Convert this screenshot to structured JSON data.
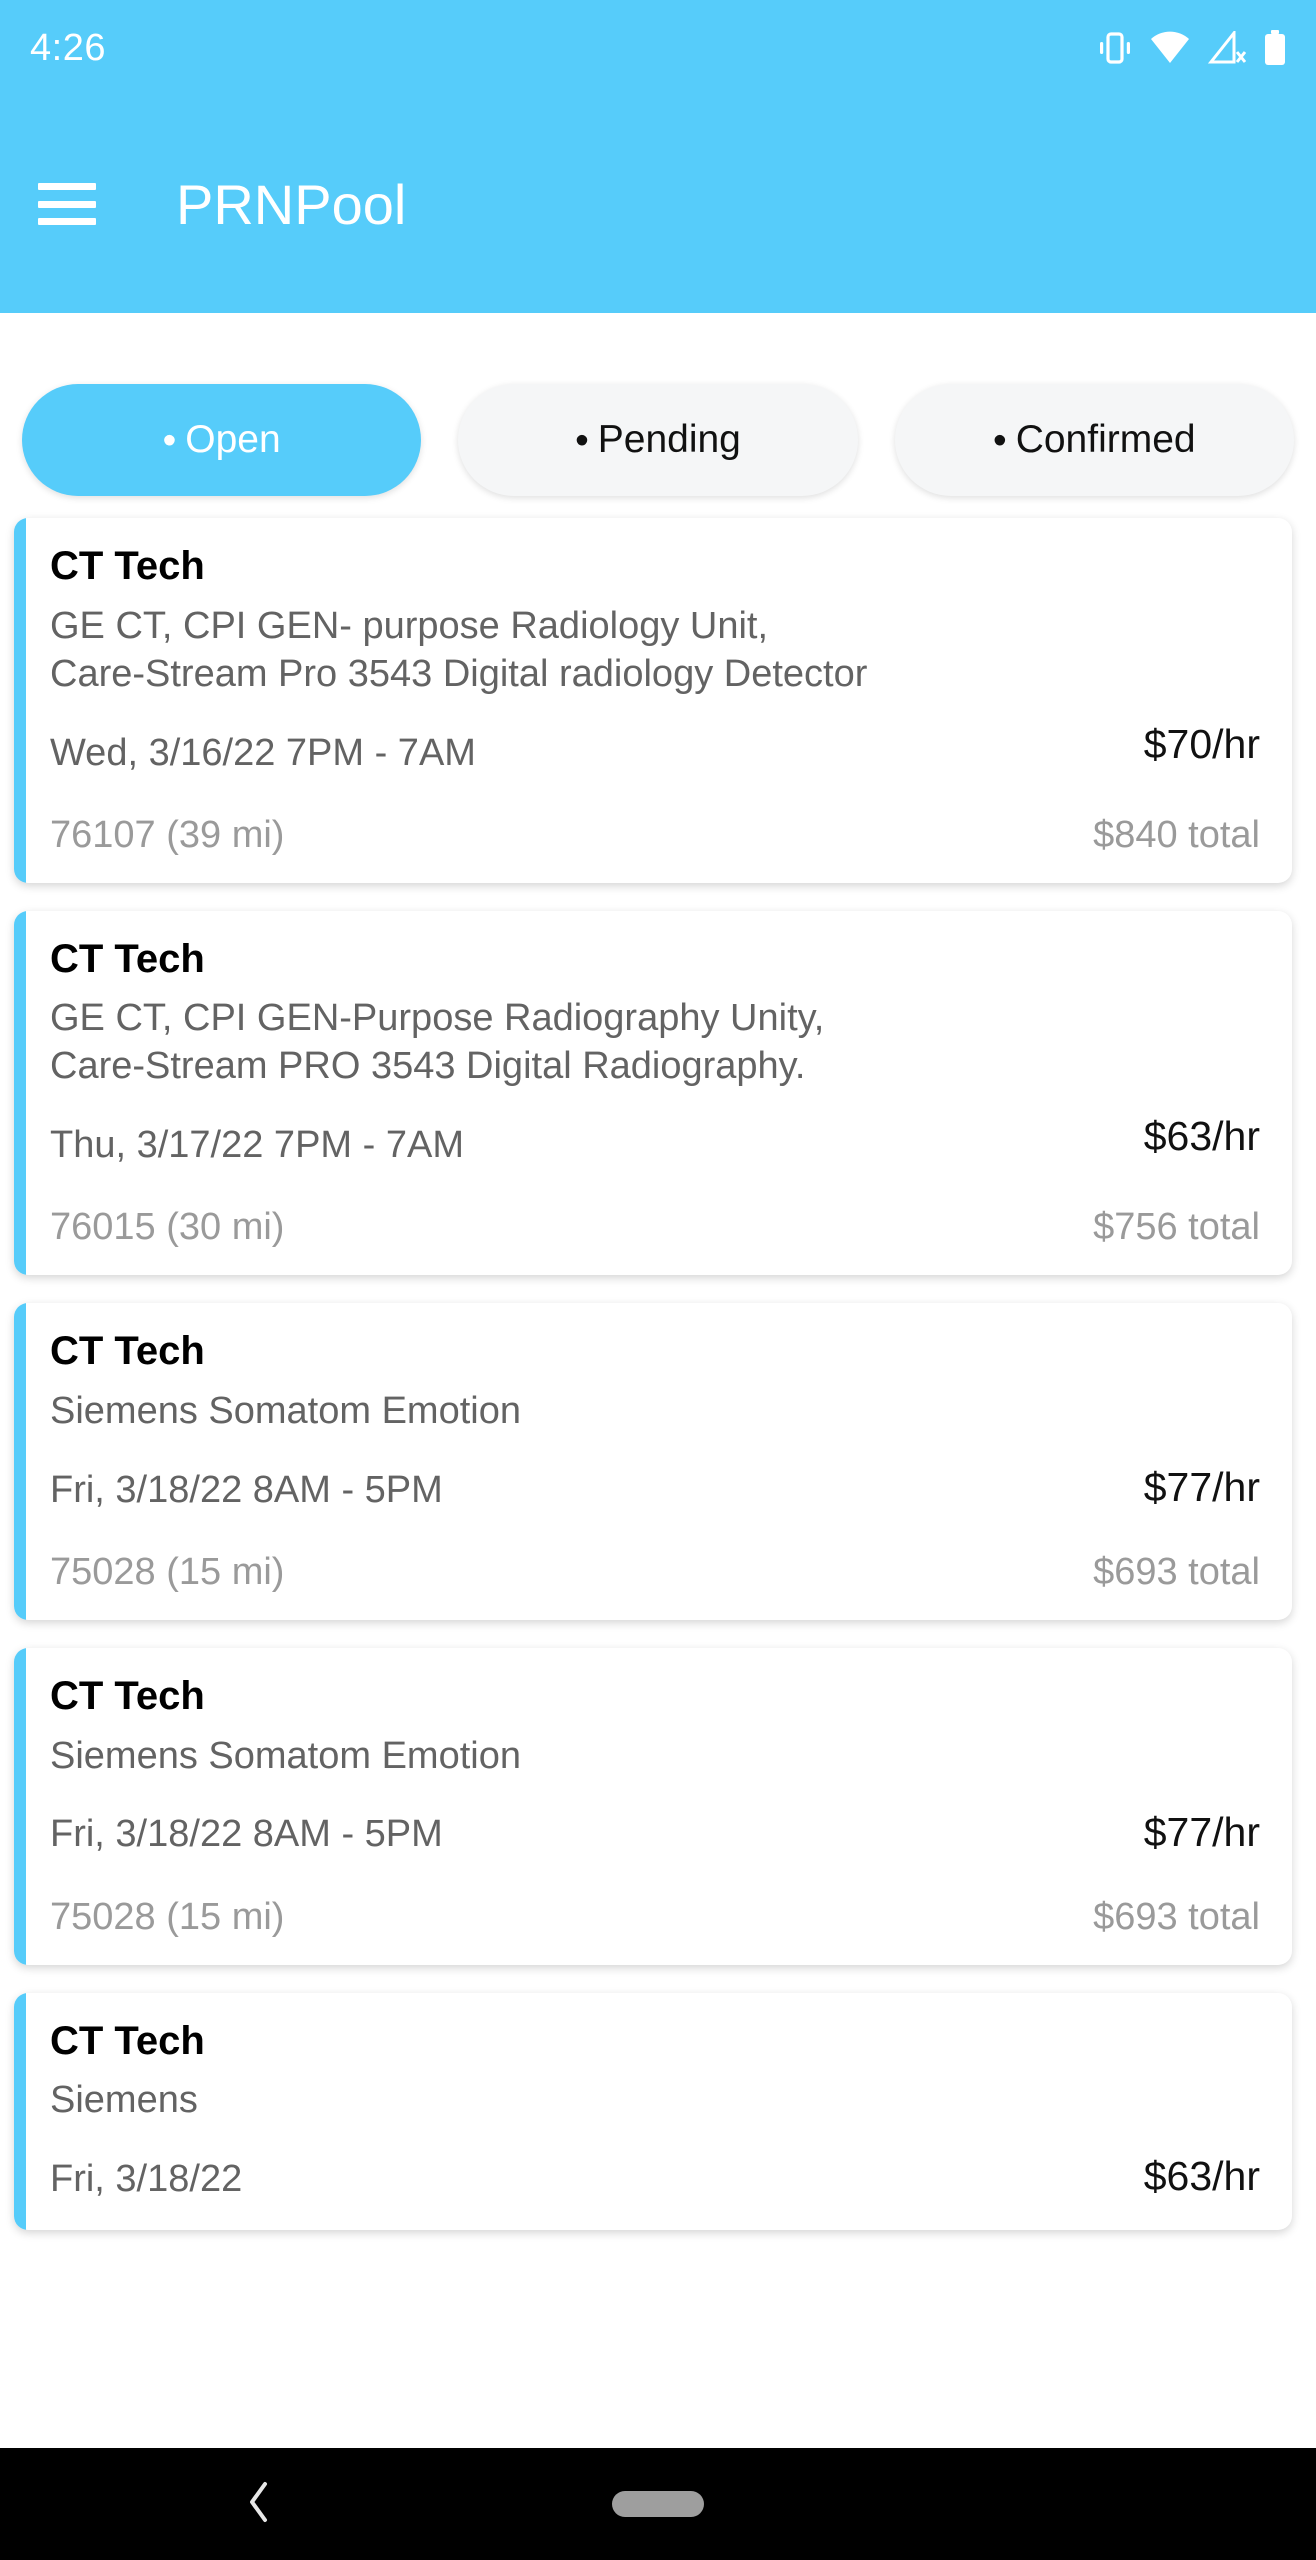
{
  "status_bar": {
    "time": "4:26",
    "icons": [
      "vibrate-icon",
      "wifi-icon",
      "signal-off-icon",
      "battery-icon"
    ]
  },
  "app_bar": {
    "menu_icon": "hamburger-menu-icon",
    "title": "PRNPool"
  },
  "theme": {
    "primary": "#56CCFA",
    "accent_stripe": "#56CCFA",
    "chip_inactive_bg": "#F5F6F7",
    "body_text": "#636363",
    "muted_text": "#9a9a9a",
    "background": "#FFFFFF",
    "nav_bar": "#000000"
  },
  "filters": {
    "dot": "•",
    "tabs": [
      {
        "label": "Open",
        "active": true
      },
      {
        "label": "Pending",
        "active": false
      },
      {
        "label": "Confirmed",
        "active": false
      }
    ]
  },
  "shifts": [
    {
      "title": "CT Tech",
      "equipment": "GE CT, CPI GEN- purpose Radiology Unit,\nCare-Stream Pro 3543 Digital radiology Detector",
      "date": "Wed, 3/16/22",
      "time": "7PM - 7AM",
      "when": "Wed, 3/16/22\n7PM - 7AM",
      "zip": "76107 (39 mi)",
      "rate": "$70/hr",
      "total": "$840 total"
    },
    {
      "title": "CT Tech",
      "equipment": "GE CT, CPI GEN-Purpose Radiography Unity,\nCare-Stream PRO 3543 Digital Radiography.",
      "date": "Thu, 3/17/22",
      "time": "7PM - 7AM",
      "when": "Thu, 3/17/22\n7PM - 7AM",
      "zip": "76015 (30 mi)",
      "rate": "$63/hr",
      "total": "$756 total"
    },
    {
      "title": "CT Tech",
      "equipment": "Siemens Somatom Emotion",
      "date": "Fri, 3/18/22",
      "time": "8AM - 5PM",
      "when": "Fri, 3/18/22\n8AM - 5PM",
      "zip": "75028 (15 mi)",
      "rate": "$77/hr",
      "total": "$693 total"
    },
    {
      "title": "CT Tech",
      "equipment": "Siemens Somatom Emotion",
      "date": "Fri, 3/18/22",
      "time": "8AM - 5PM",
      "when": "Fri, 3/18/22\n8AM - 5PM",
      "zip": "75028 (15 mi)",
      "rate": "$77/hr",
      "total": "$693 total"
    },
    {
      "title": "CT Tech",
      "equipment": "Siemens",
      "date": "Fri, 3/18/22",
      "time": "",
      "when": "Fri, 3/18/22",
      "zip": "",
      "rate": "$63/hr",
      "total": ""
    }
  ],
  "nav_bar": {
    "back_icon": "back-chevron-icon",
    "home_icon": "home-pill-icon"
  }
}
